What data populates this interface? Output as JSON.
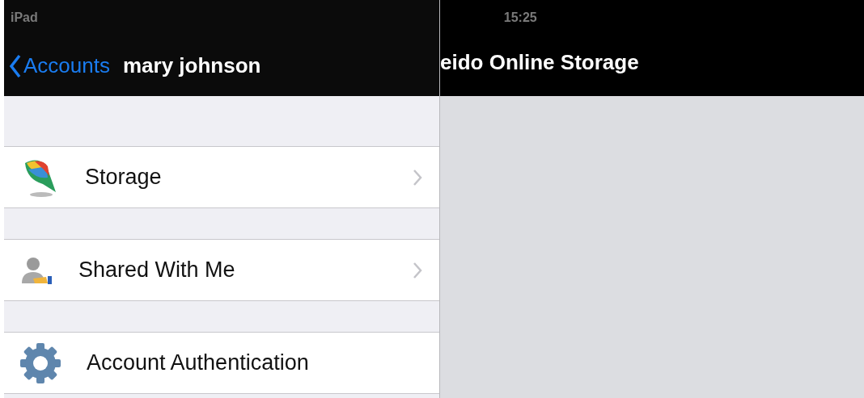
{
  "status_bar": {
    "device": "iPad",
    "time": "15:25"
  },
  "master": {
    "back_label": "Accounts",
    "title": "mary johnson",
    "rows": [
      {
        "label": "Storage",
        "kind": "storage",
        "disclosure": true
      },
      {
        "label": "Shared With Me",
        "kind": "shared",
        "disclosure": true
      },
      {
        "label": "Account Authentication",
        "kind": "settings",
        "disclosure": false
      }
    ]
  },
  "detail": {
    "title": "eido Online Storage"
  }
}
